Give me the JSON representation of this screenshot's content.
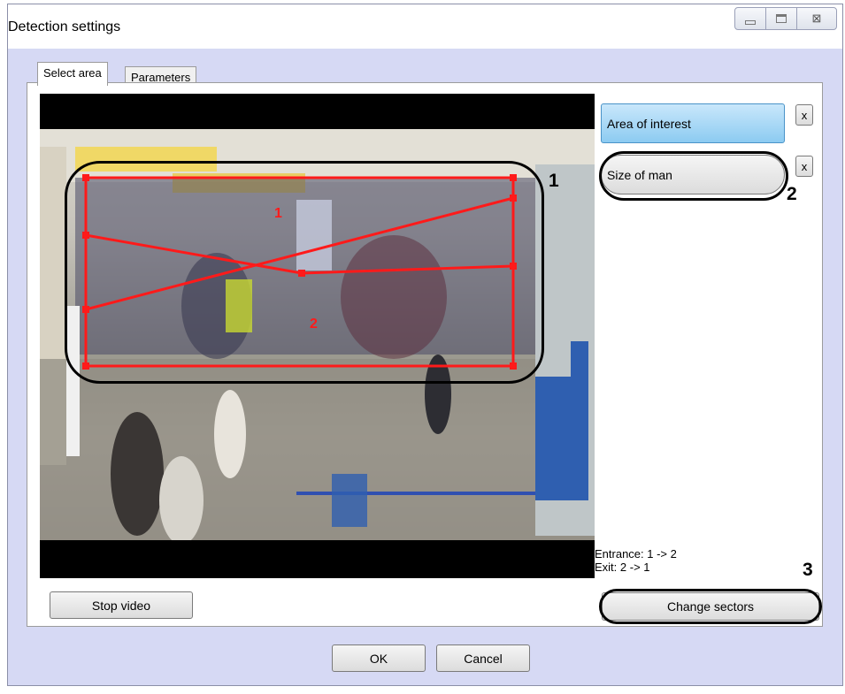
{
  "window": {
    "title": "Detection settings",
    "controls": [
      "minimize",
      "maximize",
      "close"
    ],
    "close_glyph": "⊠"
  },
  "tabs": [
    {
      "label": "Select area",
      "active": true
    },
    {
      "label": "Parameters",
      "active": false
    }
  ],
  "video": {
    "overlay_labels": [
      "1",
      "2"
    ],
    "line_color": "#ff1a1a"
  },
  "side_panel": {
    "area_of_interest_label": "Area of interest",
    "size_of_man_label": "Size of man",
    "remove_label": "x",
    "entrance_text": "Entrance: 1 -> 2",
    "exit_text": "Exit: 2 -> 1",
    "change_sectors_label": "Change sectors"
  },
  "stop_video_label": "Stop video",
  "footer": {
    "ok_label": "OK",
    "cancel_label": "Cancel"
  },
  "callouts": [
    "1",
    "2",
    "3"
  ],
  "colors": {
    "window_bg": "#d6d9f4",
    "selected_button": "#8ccbf1",
    "overlay_red": "#ff1a1a"
  }
}
